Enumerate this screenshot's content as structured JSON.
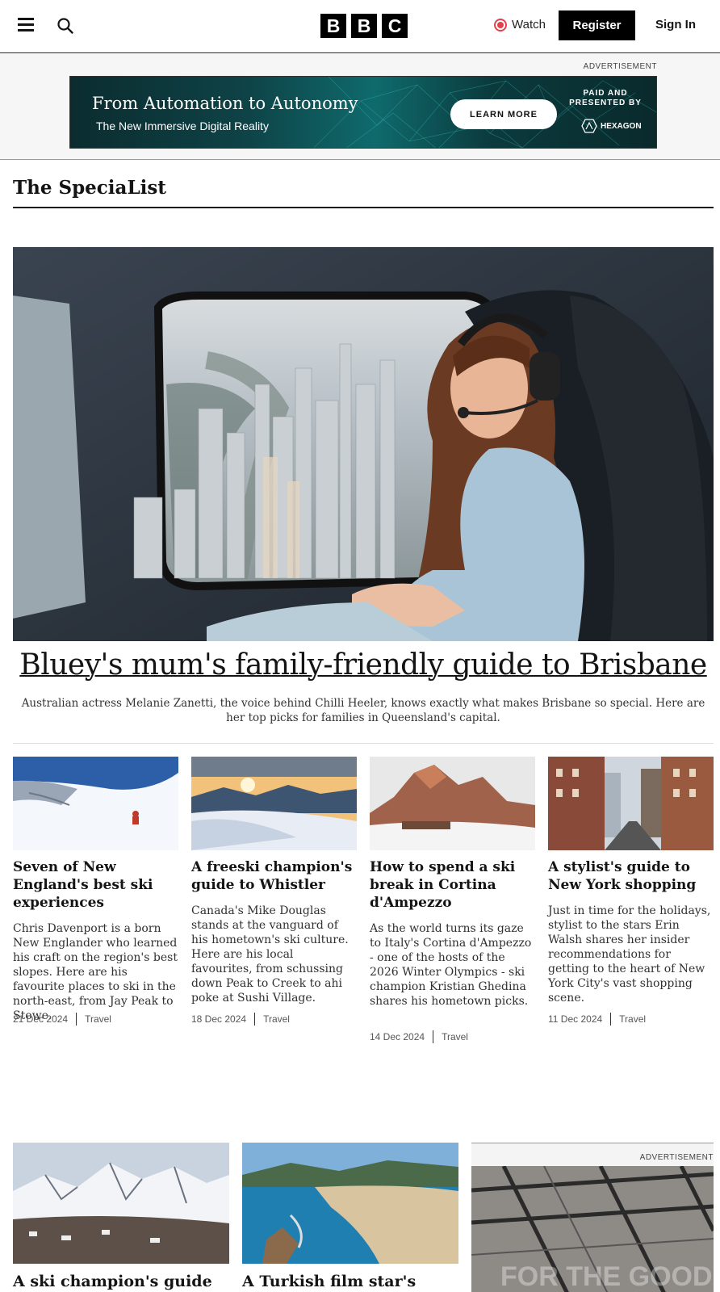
{
  "header": {
    "logo_letters": [
      "B",
      "B",
      "C"
    ],
    "watch_label": "Watch",
    "register_label": "Register",
    "signin_label": "Sign In"
  },
  "top_ad": {
    "label": "ADVERTISEMENT",
    "headline": "From Automation to Autonomy",
    "subhead": "The New Immersive Digital Reality",
    "cta": "LEARN MORE",
    "paid_by": "PAID AND PRESENTED BY",
    "brand": "HEXAGON"
  },
  "section": {
    "title": "The SpeciaList"
  },
  "hero": {
    "title": "Bluey's mum's family-friendly guide to Brisbane",
    "description": "Australian actress Melanie Zanetti, the voice behind Chilli Heeler, knows exactly what makes Brisbane so special. Here are her top picks for families in Queensland's capital."
  },
  "cards": [
    {
      "title": "Seven of New England's best ski experiences",
      "description": "Chris Davenport is a born New Englander who learned his craft on the region's best slopes. Here are his favourite places to ski in the north-east, from Jay Peak to Stowe.",
      "date": "21 Dec 2024",
      "category": "Travel"
    },
    {
      "title": "A freeski champion's guide to Whistler",
      "description": "Canada's Mike Douglas stands at the vanguard of his hometown's ski culture. Here are his local favourites, from schussing down Peak to Creek to ahi poke at Sushi Village.",
      "date": "18 Dec 2024",
      "category": "Travel"
    },
    {
      "title": "How to spend a ski break in Cortina d'Ampezzo",
      "description": "As the world turns its gaze to Italy's Cortina d'Ampezzo - one of the hosts of the 2026 Winter Olympics - ski champion Kristian Ghedina shares his hometown picks.",
      "date": "14 Dec 2024",
      "category": "Travel"
    },
    {
      "title": "A stylist's guide to New York shopping",
      "description": "Just in time for the holidays, stylist to the stars Erin Walsh shares her insider recommendations for getting to the heart of New York City's vast shopping scene.",
      "date": "11 Dec 2024",
      "category": "Travel"
    }
  ],
  "bottom_cards": [
    {
      "title": "A ski champion's guide to La Plagne, France"
    },
    {
      "title": "A Turkish film star's guide to Alanya"
    }
  ],
  "side_ad": {
    "label": "ADVERTISEMENT",
    "overlay_text": "FOR THE GOOD"
  }
}
